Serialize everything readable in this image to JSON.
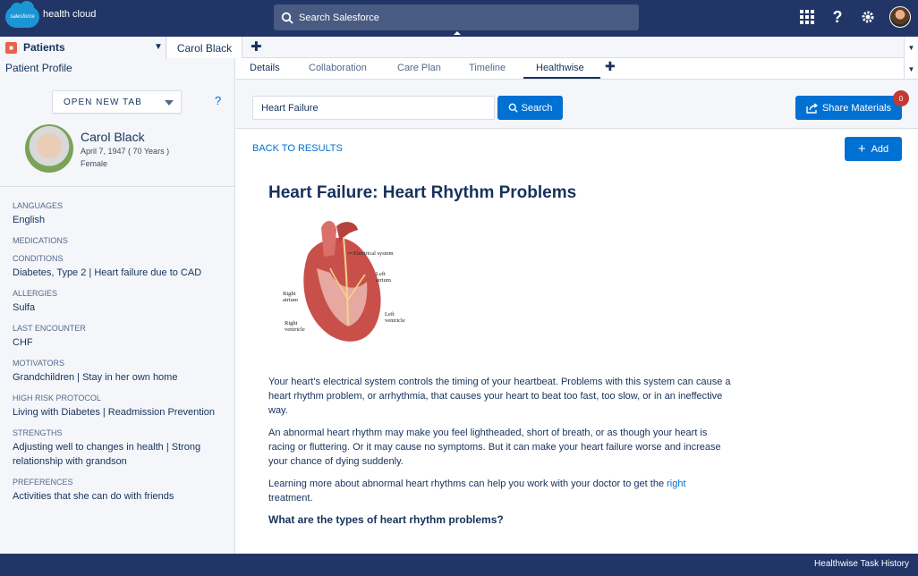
{
  "brand": {
    "logo_text": "salesforce",
    "app_name": "health cloud"
  },
  "global_search": {
    "placeholder": "Search Salesforce"
  },
  "tabs": {
    "object_label": "Patients",
    "record_tab": "Carol Black"
  },
  "sidebar": {
    "title": "Patient Profile",
    "open_new_tab": "OPEN NEW TAB",
    "help": "?",
    "patient": {
      "name": "Carol Black",
      "dob": "April 7, 1947 ( 70 Years )",
      "sex": "Female"
    },
    "fields": [
      {
        "label": "LANGUAGES",
        "value": "English"
      },
      {
        "label": "MEDICATIONS",
        "value": ""
      },
      {
        "label": "CONDITIONS",
        "value": "Diabetes, Type 2 | Heart failure due to CAD"
      },
      {
        "label": "ALLERGIES",
        "value": "Sulfa"
      },
      {
        "label": "LAST ENCOUNTER",
        "value": "CHF"
      },
      {
        "label": "MOTIVATORS",
        "value": "Grandchildren | Stay in her own home"
      },
      {
        "label": "HIGH RISK PROTOCOL",
        "value": "Living with Diabetes | Readmission Prevention"
      },
      {
        "label": "STRENGTHS",
        "value": "Adjusting well to changes in health | Strong relationship with grandson"
      },
      {
        "label": "PREFERENCES",
        "value": "Activities that she can do with friends"
      }
    ]
  },
  "subtabs": [
    "Details",
    "Collaboration",
    "Care Plan",
    "Timeline",
    "Healthwise"
  ],
  "healthwise": {
    "search_value": "Heart Failure",
    "search_button": "Search",
    "share_button": "Share Materials",
    "share_count": "0",
    "back_link": "BACK TO RESULTS",
    "add_button": "Add"
  },
  "article": {
    "title": "Heart Failure: Heart Rhythm Problems",
    "figure_labels": {
      "electrical": "Electrical system",
      "left_atrium": "Left atrium",
      "right_atrium": "Right atrium",
      "left_ventricle": "Left ventricle",
      "right_ventricle": "Right ventricle"
    },
    "paragraphs": [
      "Your heart's electrical system controls the timing of your heartbeat. Problems with this system can cause a heart rhythm problem, or arrhythmia, that causes your heart to beat too fast, too slow, or in an ineffective way.",
      "An abnormal heart rhythm may make you feel lightheaded, short of breath, or as though your heart is racing or fluttering. Or it may cause no symptoms. But it can make your heart failure worse and increase your chance of dying suddenly."
    ],
    "learn_text": "Learning more about abnormal heart rhythms can help you work with your doctor to get the ",
    "learn_link": "right",
    "learn_tail": " treatment.",
    "subheading": "What are the types of heart rhythm problems?"
  },
  "status_bar": {
    "label": "Healthwise Task History"
  },
  "colors": {
    "nav": "#213667",
    "accent": "#0070d2",
    "badge": "#c23934"
  }
}
